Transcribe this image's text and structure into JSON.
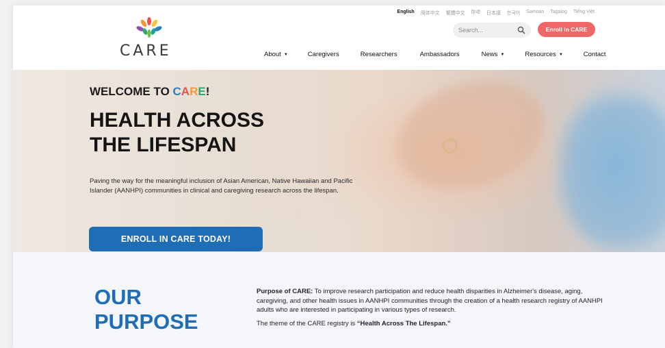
{
  "header": {
    "languages": [
      {
        "label": "English",
        "active": true
      },
      {
        "label": "简体中文",
        "active": false
      },
      {
        "label": "繁體中文",
        "active": false
      },
      {
        "label": "हिन्दी",
        "active": false
      },
      {
        "label": "日本語",
        "active": false
      },
      {
        "label": "한국어",
        "active": false
      },
      {
        "label": "Samoan",
        "active": false
      },
      {
        "label": "Tagalog",
        "active": false
      },
      {
        "label": "Tiếng Việt",
        "active": false
      }
    ],
    "logo_text": "CARE",
    "search": {
      "placeholder": "Search...",
      "value": ""
    },
    "enroll_button": "Enroll in CARE",
    "nav": [
      {
        "label": "About",
        "dropdown": true
      },
      {
        "label": "Caregivers",
        "dropdown": false
      },
      {
        "label": "Researchers",
        "dropdown": false
      },
      {
        "label": "Ambassadors",
        "dropdown": false
      },
      {
        "label": "News",
        "dropdown": true
      },
      {
        "label": "Resources",
        "dropdown": true
      },
      {
        "label": "Contact",
        "dropdown": false
      }
    ]
  },
  "hero": {
    "welcome_prefix": "WELCOME TO ",
    "welcome_brand": [
      "C",
      "A",
      "R",
      "E"
    ],
    "welcome_suffix": "!",
    "headline_line1": "HEALTH ACROSS",
    "headline_line2": "THE LIFESPAN",
    "description": "Paving the way for the meaningful inclusion of Asian American, Native Hawaiian and Pacific Islander (AANHPI) communities in clinical and caregiving research across the lifespan.",
    "cta": "ENROLL IN CARE TODAY!"
  },
  "purpose": {
    "title_line1": "OUR",
    "title_line2": "PURPOSE",
    "label": "Purpose of CARE:",
    "text": " To improve research participation and reduce health disparities in Alzheimer's disease, aging, caregiving, and other health issues in AANHPI communities through the creation of a health research registry of AANHPI adults who are interested in participating in various types of research.",
    "theme_prefix": "The theme of the CARE registry is ",
    "theme_quote": "“Health Across The Lifespan.”"
  },
  "colors": {
    "primary_blue": "#1f6db5",
    "enroll_red": "#ef6767",
    "brand_c": "#2f80b9",
    "brand_a": "#e0524c",
    "brand_r": "#f39a36",
    "brand_e": "#2fa86a"
  },
  "icons": {
    "search": "search-icon",
    "logo": "flower-logo-icon",
    "caret": "caret-down-icon"
  }
}
